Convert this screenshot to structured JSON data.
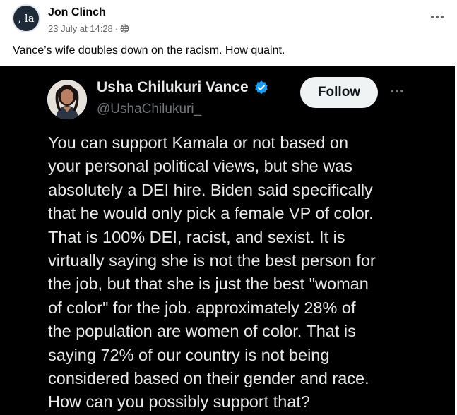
{
  "post": {
    "author": "Jon Clinch",
    "avatar_text": ", la",
    "date": "23 July at 14:28",
    "separator": "·",
    "privacy_icon": "globe-icon",
    "more_icon": "more-horizontal-icon",
    "text": "Vance’s wife doubles down on the racism. How quaint."
  },
  "tweet": {
    "name": "Usha Chilukuri Vance",
    "handle": "@UshaChilukuri_",
    "verified_icon": "verified-badge-icon",
    "follow_label": "Follow",
    "more_icon": "more-horizontal-icon",
    "body": "You can support Kamala or not based on\nyour personal political views, but she was\nabsolutely a DEI hire. Biden said specifically\nthat he would only pick a female VP of color.\nThat is 100% DEI, racist, and sexist. It is\nvirtually saying she is not the best person for\nthe job, but that she is just the best \"woman\nof color\" for the job. approximately 28% of\nthe population are women of color. That is\nsaying 72% of our country is not being\nconsidered based on their gender and race.\nHow can you possibly support that?"
  },
  "colors": {
    "tweet_background": "#000000",
    "tweet_text": "#e7e9ea",
    "tweet_handle": "#71767b",
    "verified_blue": "#1d9bf0",
    "fb_meta_grey": "#65676b"
  }
}
